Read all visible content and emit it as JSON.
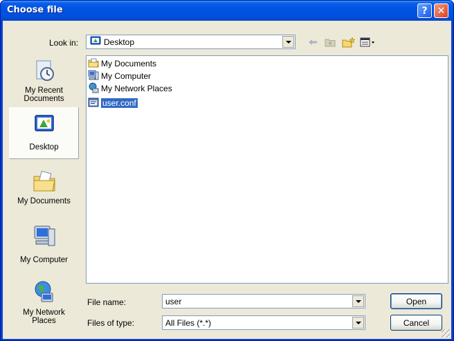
{
  "window": {
    "title": "Choose file",
    "help_glyph": "?",
    "close_glyph": "✕"
  },
  "lookin": {
    "label": "Look in:",
    "value": "Desktop"
  },
  "places": [
    {
      "label": "My Recent\nDocuments",
      "icon": "recent-documents-icon"
    },
    {
      "label": "Desktop",
      "icon": "desktop-icon"
    },
    {
      "label": "My Documents",
      "icon": "my-documents-icon"
    },
    {
      "label": "My Computer",
      "icon": "my-computer-icon"
    },
    {
      "label": "My Network\nPlaces",
      "icon": "network-places-icon"
    }
  ],
  "files": [
    {
      "name": "My Documents",
      "icon": "my-documents-icon"
    },
    {
      "name": "My Computer",
      "icon": "my-computer-icon"
    },
    {
      "name": "My Network Places",
      "icon": "network-places-icon"
    },
    {
      "name": "user.conf",
      "icon": "conf-file-icon",
      "selected": true
    }
  ],
  "filename": {
    "label": "File name:",
    "value": "user"
  },
  "filetype": {
    "label": "Files of type:",
    "value": "All Files (*.*)"
  },
  "buttons": {
    "open": "Open",
    "cancel": "Cancel"
  },
  "colors": {
    "title_bar": "#0054e3",
    "selection": "#316ac5",
    "dialog_bg": "#ece9d8"
  }
}
